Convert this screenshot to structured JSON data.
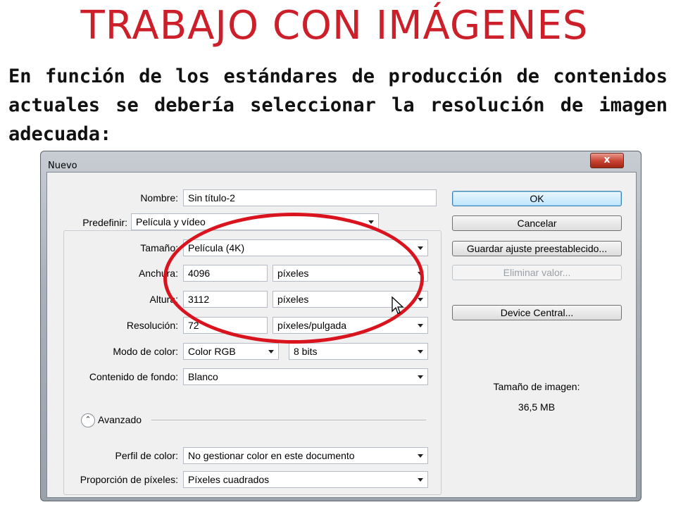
{
  "slide": {
    "title": "TRABAJO CON IMÁGENES",
    "text": "En función de los estándares de producción de contenidos actuales se debería seleccionar la resolución de imagen adecuada:"
  },
  "dialog": {
    "title": "Nuevo",
    "close_label": "x",
    "nombre": {
      "label": "Nombre:",
      "value": "Sin título-2"
    },
    "predefinir": {
      "label": "Predefinir:",
      "value": "Película y vídeo"
    },
    "tamano": {
      "label": "Tamaño:",
      "value": "Película (4K)"
    },
    "anchura": {
      "label": "Anchura:",
      "value": "4096",
      "unit": "píxeles"
    },
    "altura": {
      "label": "Altura:",
      "value": "3112",
      "unit": "píxeles"
    },
    "resolucion": {
      "label": "Resolución:",
      "value": "72",
      "unit": "píxeles/pulgada"
    },
    "modo_color": {
      "label": "Modo de color:",
      "value": "Color RGB",
      "depth": "8 bits"
    },
    "contenido_fondo": {
      "label": "Contenido de fondo:",
      "value": "Blanco"
    },
    "avanzado": {
      "label": "Avanzado"
    },
    "perfil_color": {
      "label": "Perfil de color:",
      "value": "No gestionar color en este documento"
    },
    "proporcion": {
      "label": "Proporción de píxeles:",
      "value": "Píxeles cuadrados"
    },
    "buttons": {
      "ok": "OK",
      "cancel": "Cancelar",
      "save_preset": "Guardar ajuste preestablecido...",
      "delete_preset": "Eliminar valor...",
      "device_central": "Device Central..."
    },
    "image_size": {
      "label": "Tamaño de imagen:",
      "value": "36,5 MB"
    }
  },
  "colors": {
    "title_red": "#cc1f2a",
    "annotation_red": "#d9141e"
  }
}
